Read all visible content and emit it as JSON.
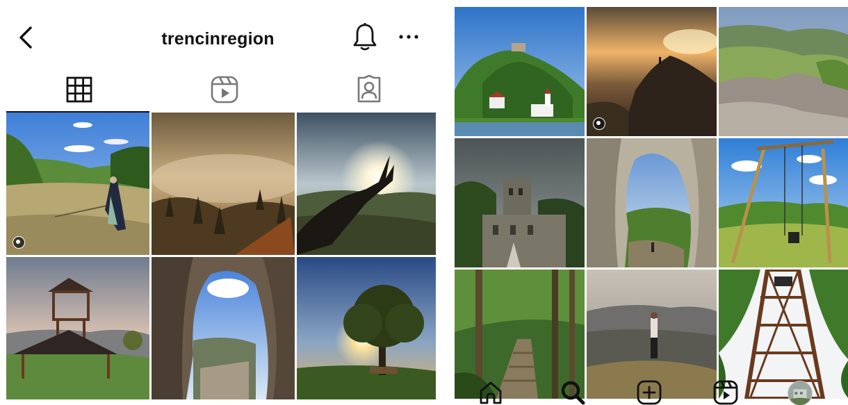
{
  "profile": {
    "username": "trencinregion"
  },
  "icons": {
    "back": "chevron-left-icon",
    "notifications": "bell-icon",
    "more": "more-horizontal-icon",
    "grid_tab": "grid-icon",
    "reels_tab": "reels-icon",
    "tagged_tab": "tagged-person-icon",
    "home": "home-icon",
    "search": "search-icon",
    "create": "plus-square-icon",
    "reels": "reels-icon",
    "profile": "profile-avatar-icon"
  },
  "left_grid": [
    {
      "subject": "meadow-haymaker",
      "is_reel": true
    },
    {
      "subject": "foggy-forest",
      "is_reel": false
    },
    {
      "subject": "hand-sunburst",
      "is_reel": false
    },
    {
      "subject": "wooden-lookout-tower",
      "is_reel": false
    },
    {
      "subject": "rock-arch-view",
      "is_reel": false
    },
    {
      "subject": "lone-tree-sunset",
      "is_reel": false
    }
  ],
  "right_grid": [
    {
      "subject": "castle-hill-village",
      "is_reel": false
    },
    {
      "subject": "rock-sunset-hiker",
      "is_reel": true
    },
    {
      "subject": "rocky-ridge-valley",
      "is_reel": false
    },
    {
      "subject": "castle-ruins",
      "is_reel": false
    },
    {
      "subject": "rock-arch-hiker",
      "is_reel": false
    },
    {
      "subject": "giant-swing",
      "is_reel": false
    },
    {
      "subject": "forest-stairs",
      "is_reel": false
    },
    {
      "subject": "hiker-mountain-view",
      "is_reel": false
    },
    {
      "subject": "tower-from-below",
      "is_reel": false
    }
  ],
  "colors": {
    "text": "#111111",
    "background": "#ffffff"
  }
}
